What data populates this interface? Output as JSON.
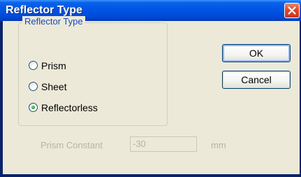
{
  "window": {
    "title": "Reflector Type",
    "close_icon": "close-x-icon",
    "close_color": "#e0482a"
  },
  "group": {
    "legend": "Reflector Type",
    "options": [
      {
        "label": "Prism",
        "selected": false
      },
      {
        "label": "Sheet",
        "selected": false
      },
      {
        "label": "Reflectorless",
        "selected": true
      }
    ]
  },
  "buttons": {
    "ok": "OK",
    "cancel": "Cancel"
  },
  "prism_constant": {
    "label": "Prism Constant",
    "value": "-30",
    "unit": "mm",
    "enabled": false
  },
  "colors": {
    "titlebar": "#0055e5",
    "dialog_face": "#ece9d8",
    "legend_text": "#1c49b8",
    "disabled_text": "#b4b4a9"
  }
}
